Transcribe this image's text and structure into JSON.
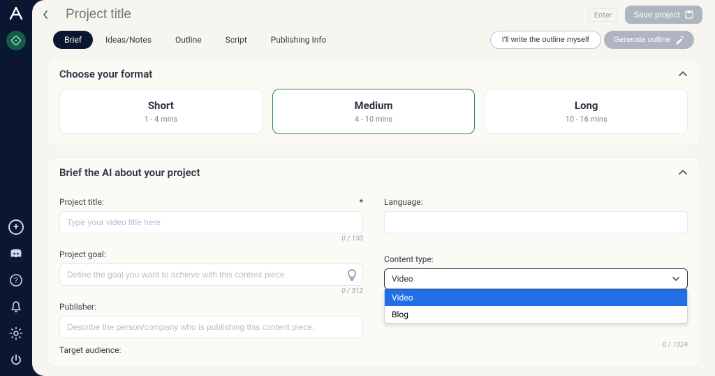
{
  "title_placeholder": "Project title",
  "topbar": {
    "enter_hint": "Enter",
    "save_label": "Save project"
  },
  "tabs": [
    {
      "label": "Brief",
      "active": true
    },
    {
      "label": "Ideas/Notes",
      "active": false
    },
    {
      "label": "Outline",
      "active": false
    },
    {
      "label": "Script",
      "active": false
    },
    {
      "label": "Publishing Info",
      "active": false
    }
  ],
  "actions": {
    "write_outline": "I'll write the outline myself",
    "generate_outline": "Generate outline"
  },
  "format": {
    "heading": "Choose your format",
    "options": [
      {
        "name": "Short",
        "sub": "1 - 4 mins",
        "selected": false
      },
      {
        "name": "Medium",
        "sub": "4 - 10 mins",
        "selected": true
      },
      {
        "name": "Long",
        "sub": "10 - 16 mins",
        "selected": false
      }
    ]
  },
  "brief": {
    "heading": "Brief the AI about your project",
    "project_title": {
      "label": "Project title:",
      "placeholder": "Type your video title here",
      "counter": "0 / 150",
      "required": "*"
    },
    "language": {
      "label": "Language:"
    },
    "project_goal": {
      "label": "Project goal:",
      "placeholder": "Define the goal you want to achieve with this content piece",
      "counter": "0 / 512"
    },
    "content_type": {
      "label": "Content type:",
      "value": "Video",
      "options": [
        "Video",
        "Blog"
      ]
    },
    "publisher": {
      "label": "Publisher:",
      "placeholder": "Describe the person/company who is publishing this content piece.",
      "counter": "0 / 1024"
    },
    "target_audience": {
      "label": "Target audience:"
    }
  }
}
